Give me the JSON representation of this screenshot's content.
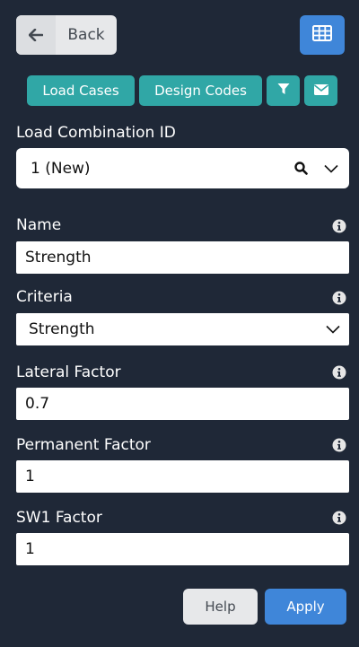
{
  "header": {
    "back_label": "Back",
    "back_icon": "arrow-left-icon",
    "grid_icon": "table-grid-icon"
  },
  "toolbar": {
    "load_cases_label": "Load Cases",
    "design_codes_label": "Design Codes",
    "filter_icon": "filter-icon",
    "email_icon": "envelope-icon"
  },
  "combination": {
    "label": "Load Combination ID",
    "value": "1 (New)"
  },
  "fields": {
    "name": {
      "label": "Name",
      "value": "Strength"
    },
    "criteria": {
      "label": "Criteria",
      "value": "Strength"
    },
    "lateral_factor": {
      "label": "Lateral Factor",
      "value": "0.7"
    },
    "permanent_factor": {
      "label": "Permanent Factor",
      "value": "1"
    },
    "sw1_factor": {
      "label": "SW1 Factor",
      "value": "1"
    }
  },
  "footer": {
    "help_label": "Help",
    "apply_label": "Apply"
  },
  "colors": {
    "background": "#1f2837",
    "teal": "#30a7a6",
    "blue": "#3f86d9",
    "light_button": "#e7e8ea"
  }
}
